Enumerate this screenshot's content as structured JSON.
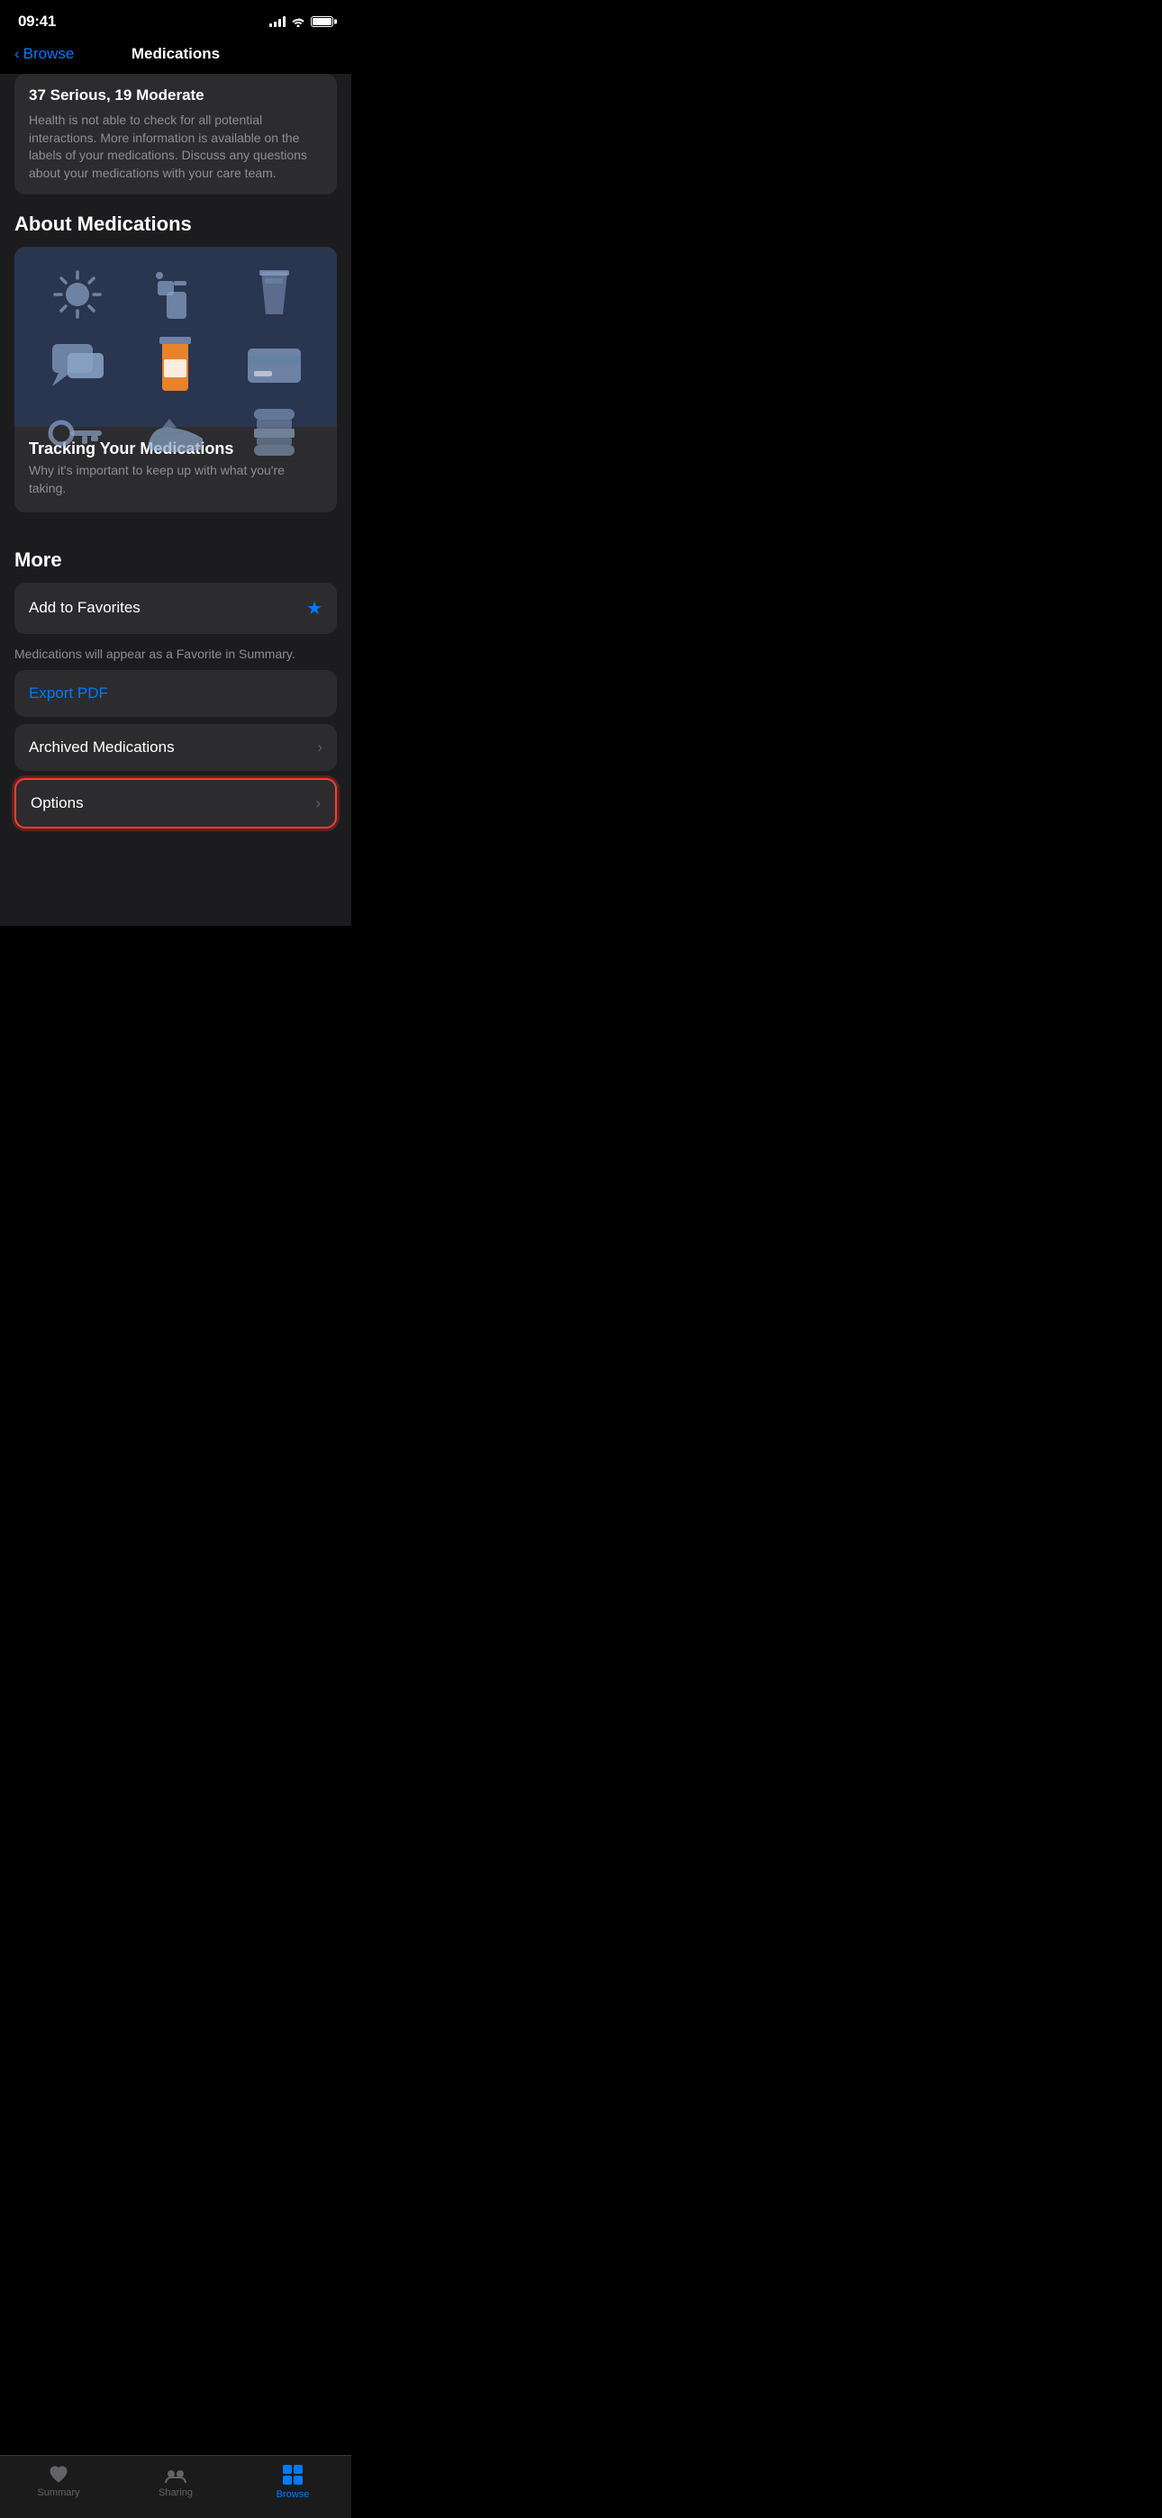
{
  "statusBar": {
    "time": "09:41",
    "batteryFull": true
  },
  "nav": {
    "backLabel": "Browse",
    "title": "Medications"
  },
  "interactions": {
    "title": "37 Serious, 19 Moderate",
    "description": "Health is not able to check for all potential interactions. More information is available on the labels of your medications. Discuss any questions about your medications with your care team."
  },
  "aboutSection": {
    "header": "About Medications",
    "card": {
      "title": "Tracking Your Medications",
      "description": "Why it's important to keep up with what you're taking."
    }
  },
  "moreSection": {
    "header": "More",
    "addToFavorites": {
      "label": "Add to Favorites",
      "hint": "Medications will appear as a Favorite in Summary."
    },
    "exportPDF": {
      "label": "Export PDF"
    },
    "archivedMedications": {
      "label": "Archived Medications"
    },
    "options": {
      "label": "Options"
    }
  },
  "tabBar": {
    "summary": {
      "label": "Summary",
      "active": false
    },
    "sharing": {
      "label": "Sharing",
      "active": false
    },
    "browse": {
      "label": "Browse",
      "active": true
    }
  }
}
